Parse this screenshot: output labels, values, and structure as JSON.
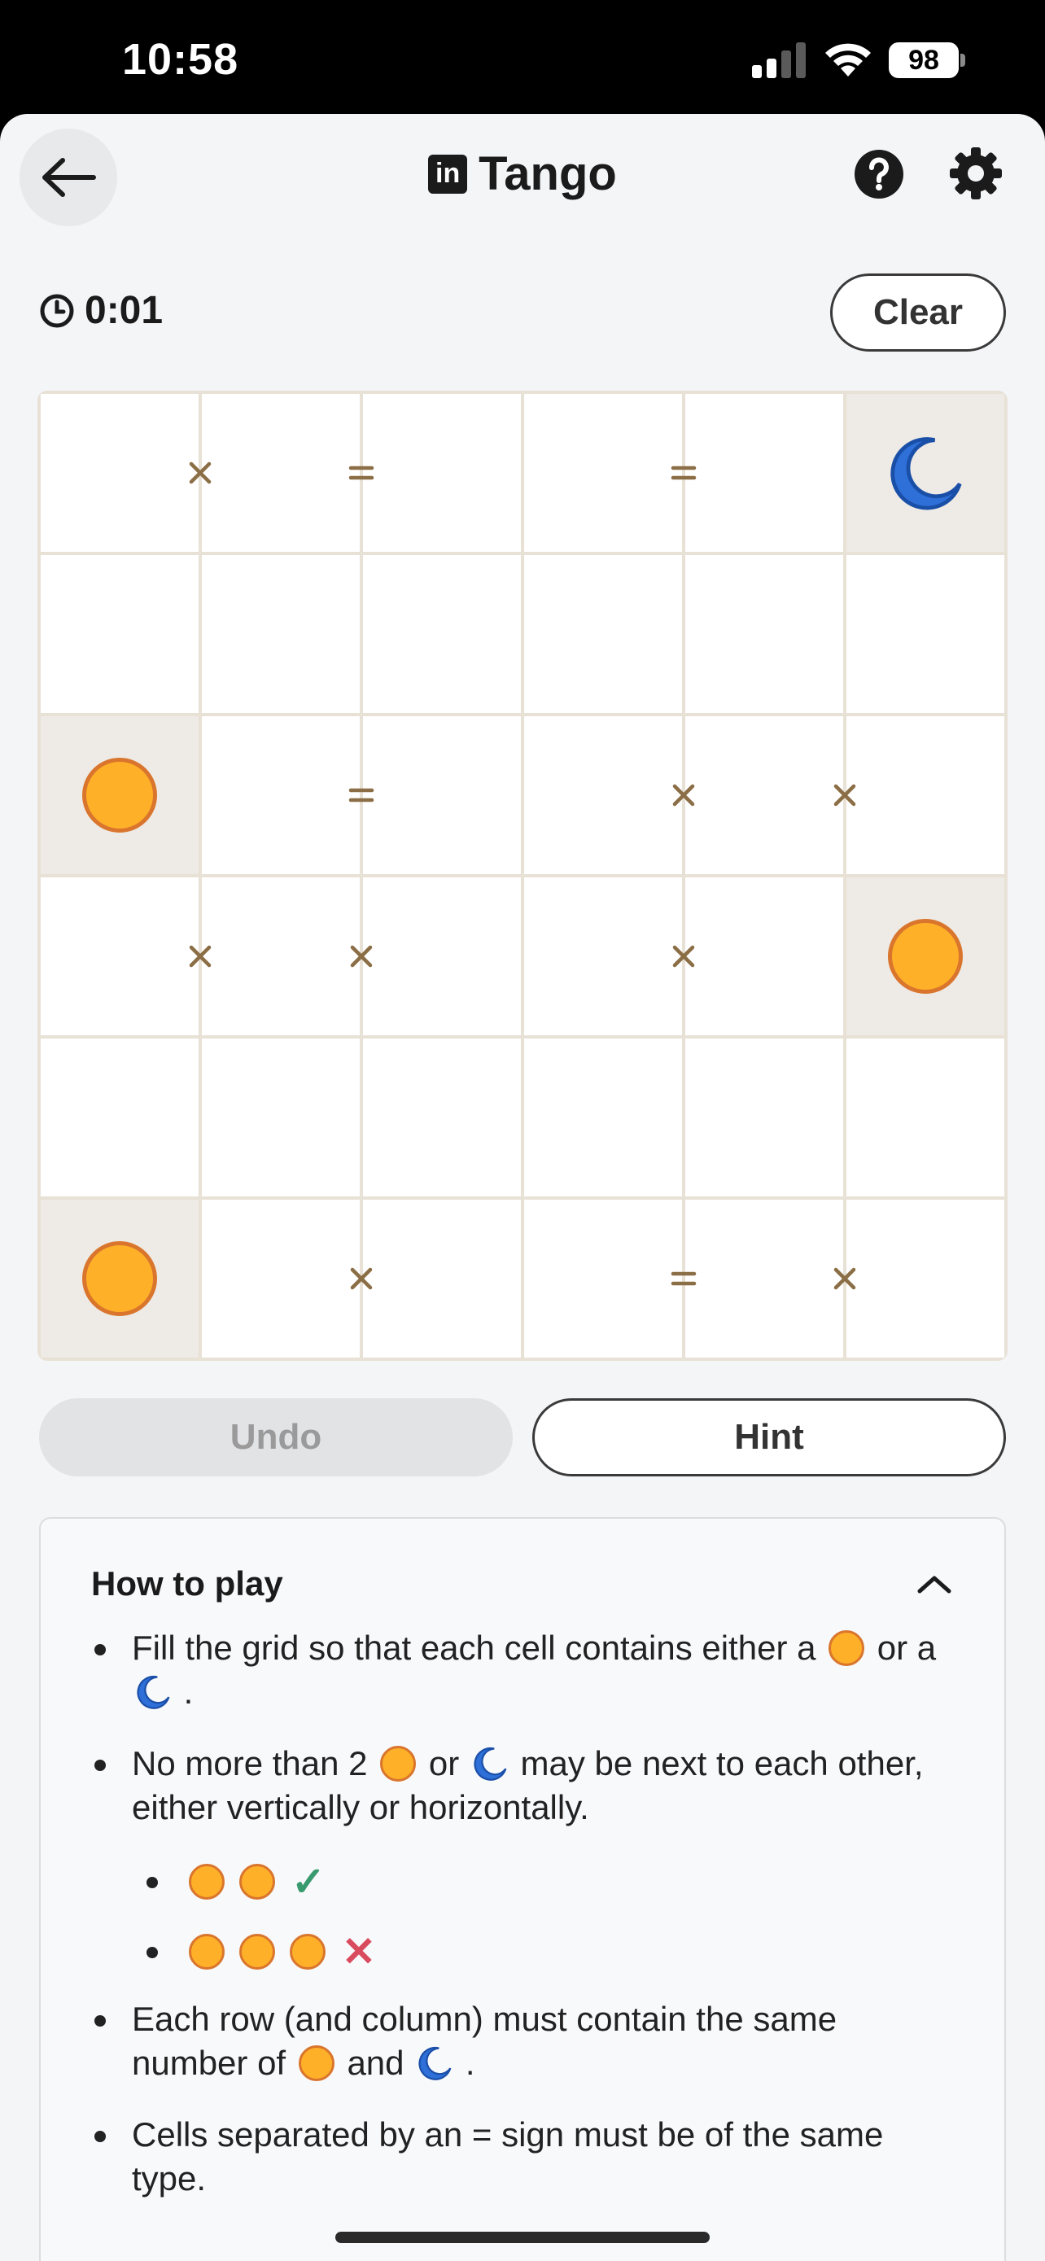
{
  "status": {
    "time": "10:58",
    "battery": "98"
  },
  "header": {
    "logo": "in",
    "title": "Tango"
  },
  "timer": {
    "value": "0:01"
  },
  "actions": {
    "clear": "Clear",
    "undo": "Undo",
    "hint": "Hint"
  },
  "board": {
    "size": 6,
    "cells": [
      [
        "",
        "",
        "",
        "",
        "",
        "moon"
      ],
      [
        "",
        "",
        "",
        "",
        "",
        ""
      ],
      [
        "sun",
        "",
        "",
        "",
        "",
        ""
      ],
      [
        "",
        "",
        "",
        "",
        "",
        "sun"
      ],
      [
        "",
        "",
        "",
        "",
        "",
        ""
      ],
      [
        "sun",
        "",
        "",
        "",
        "",
        ""
      ]
    ],
    "locked": [
      [
        0,
        5
      ],
      [
        2,
        0
      ],
      [
        3,
        5
      ],
      [
        5,
        0
      ]
    ],
    "constraints": [
      {
        "row": 0,
        "col": 0,
        "dir": "right",
        "type": "x"
      },
      {
        "row": 0,
        "col": 1,
        "dir": "right",
        "type": "="
      },
      {
        "row": 0,
        "col": 3,
        "dir": "right",
        "type": "="
      },
      {
        "row": 2,
        "col": 1,
        "dir": "right",
        "type": "="
      },
      {
        "row": 2,
        "col": 3,
        "dir": "right",
        "type": "x"
      },
      {
        "row": 2,
        "col": 4,
        "dir": "right",
        "type": "x"
      },
      {
        "row": 3,
        "col": 0,
        "dir": "right",
        "type": "x"
      },
      {
        "row": 3,
        "col": 1,
        "dir": "right",
        "type": "x"
      },
      {
        "row": 3,
        "col": 3,
        "dir": "right",
        "type": "x"
      },
      {
        "row": 5,
        "col": 1,
        "dir": "right",
        "type": "x"
      },
      {
        "row": 5,
        "col": 3,
        "dir": "right",
        "type": "="
      },
      {
        "row": 5,
        "col": 4,
        "dir": "right",
        "type": "x"
      }
    ]
  },
  "howto": {
    "title": "How to play",
    "r1a": "Fill the grid so that each cell contains either a",
    "r1b": "or a",
    "r1c": ".",
    "r2a": "No more than 2",
    "r2b": "or",
    "r2c": "may be next to each other, either vertically or horizontally.",
    "check": "✓",
    "cross": "✕",
    "r3a": "Each row (and column) must contain the same number of",
    "r3b": "and",
    "r3c": ".",
    "r4": "Cells separated by an = sign must be of the same type."
  },
  "colors": {
    "sun_fill": "#ffb029",
    "sun_stroke": "#d9752c",
    "moon": "#2e6fd8",
    "constraint": "#8b6e45"
  }
}
